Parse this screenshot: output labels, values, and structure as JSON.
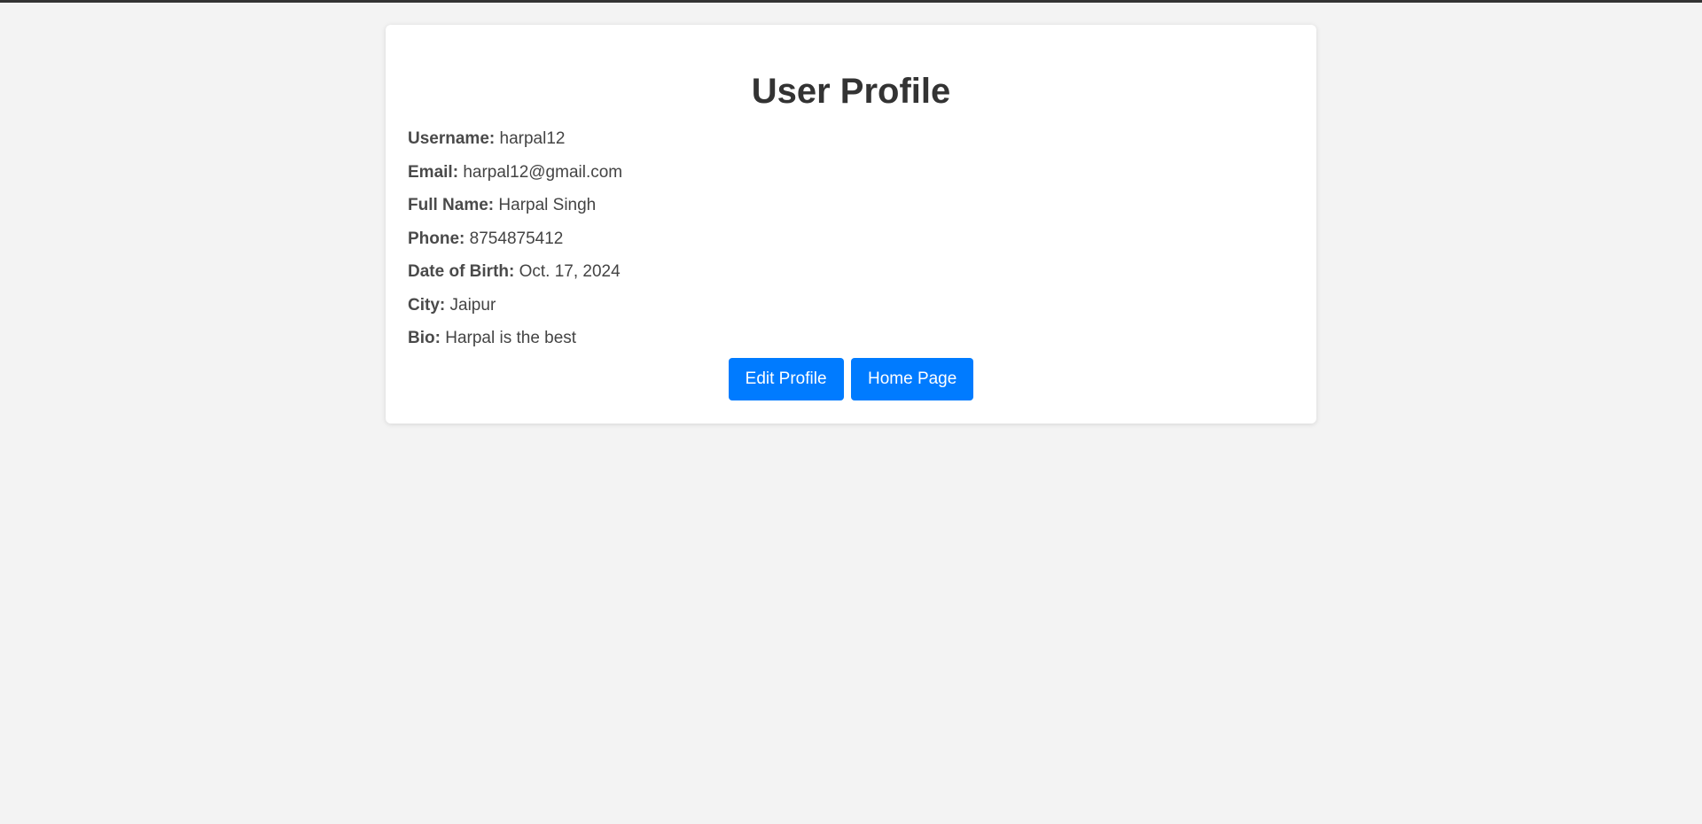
{
  "page": {
    "title": "User Profile"
  },
  "profile": {
    "fields": [
      {
        "label": "Username:",
        "value": "harpal12"
      },
      {
        "label": "Email:",
        "value": "harpal12@gmail.com"
      },
      {
        "label": "Full Name:",
        "value": "Harpal Singh"
      },
      {
        "label": "Phone:",
        "value": "8754875412"
      },
      {
        "label": "Date of Birth:",
        "value": "Oct. 17, 2024"
      },
      {
        "label": "City:",
        "value": "Jaipur"
      },
      {
        "label": "Bio:",
        "value": "Harpal is the best"
      }
    ]
  },
  "actions": {
    "edit_label": "Edit Profile",
    "home_label": "Home Page"
  },
  "colors": {
    "background": "#f3f3f3",
    "card": "#ffffff",
    "button": "#007bff",
    "title": "#333333"
  }
}
